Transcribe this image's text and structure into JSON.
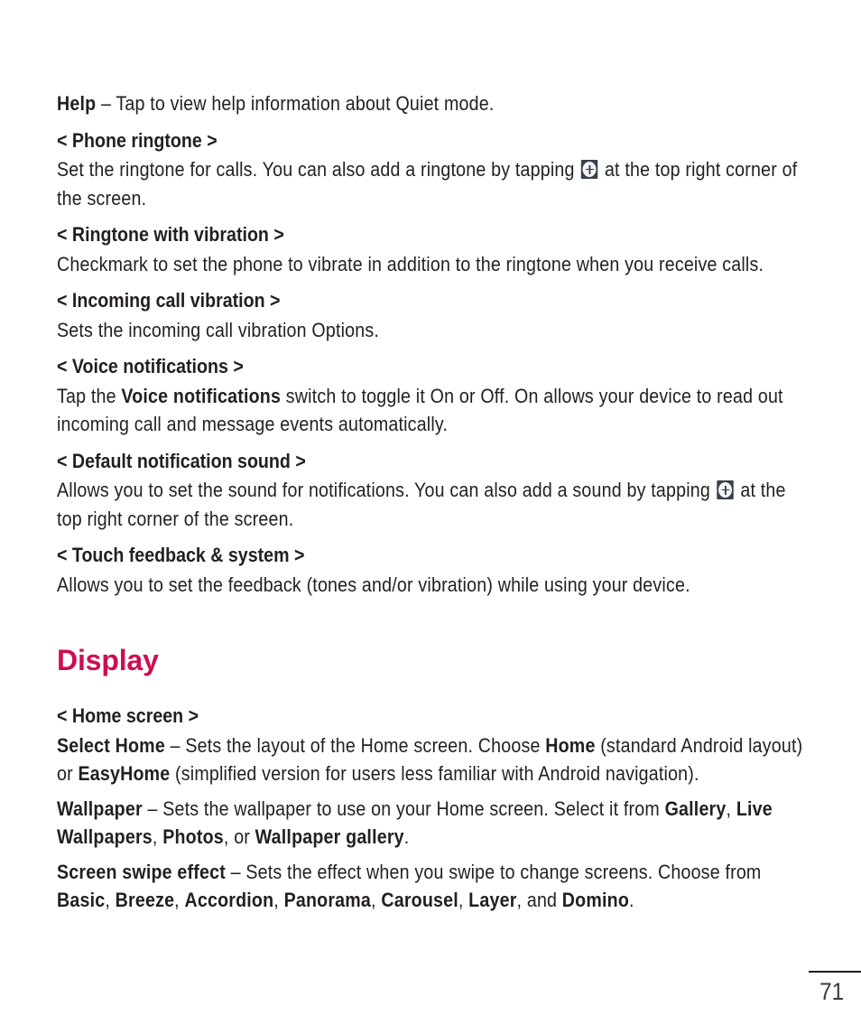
{
  "document": {
    "page_number": "71",
    "accent_color": "#ce0e4e",
    "text_color": "#231f20"
  },
  "content": {
    "help_line": {
      "term": "Help",
      "dash": " – ",
      "text": "Tap to view help information about Quiet mode."
    },
    "sections": [
      {
        "heading": "< Phone ringtone >",
        "body_pre": "Set the ringtone for calls. You can also add a ringtone by tapping ",
        "icon": "plus-icon",
        "body_post": " at the top right corner of the screen."
      },
      {
        "heading": "< Ringtone with vibration >",
        "body": "Checkmark to set the phone to vibrate in addition to the ringtone when you receive calls."
      },
      {
        "heading": "< Incoming call vibration >",
        "body": "Sets the incoming call vibration Options."
      },
      {
        "heading": "< Voice notifications >",
        "body_pre": "Tap the ",
        "body_bold": "Voice notifications",
        "body_post": " switch to toggle it On or Off. On allows your device to read out incoming call and message events automatically."
      },
      {
        "heading": "< Default notification sound >",
        "body_pre": "Allows you to set the sound for notifications. You can also add a sound by tapping ",
        "icon": "plus-icon",
        "body_post": " at the top right corner of the screen."
      },
      {
        "heading": "< Touch feedback & system >",
        "body": "Allows you to set the feedback (tones and/or vibration) while using your device."
      }
    ],
    "display_section": {
      "title": "Display",
      "home_screen_heading": "< Home screen >",
      "select_home": {
        "term": "Select Home",
        "part1": " – Sets the layout of the Home screen. Choose ",
        "bold1": "Home",
        "part2": " (standard Android layout) or ",
        "bold2": "EasyHome",
        "part3": " (simplified version for users less familiar with Android navigation)."
      },
      "wallpaper": {
        "term": "Wallpaper",
        "part1": " – Sets the wallpaper to use on your Home screen. Select it from ",
        "bold1": "Gallery",
        "part2": ", ",
        "bold2": "Live Wallpapers",
        "part3": ", ",
        "bold3": "Photos",
        "part4": ", or ",
        "bold4": "Wallpaper gallery",
        "part5": "."
      },
      "screen_swipe_effect": {
        "term": "Screen swipe effect",
        "part1": " – Sets the effect when you swipe to change screens. Choose from ",
        "bold1": "Basic",
        "part2": ", ",
        "bold2": "Breeze",
        "part3": ", ",
        "bold3": "Accordion",
        "part4": ", ",
        "bold4": "Panorama",
        "part5": ", ",
        "bold5": "Carousel",
        "part6": ", ",
        "bold6": "Layer",
        "part7": ", and ",
        "bold7": "Domino",
        "part8": "."
      }
    }
  }
}
